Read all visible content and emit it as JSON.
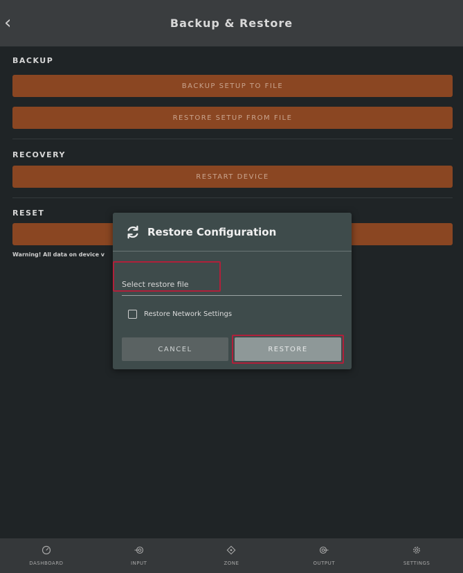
{
  "header": {
    "back_glyph": "‹",
    "title": "Backup & Restore"
  },
  "sections": {
    "backup": {
      "label": "BACKUP",
      "backup_btn": "BACKUP SETUP TO FILE",
      "restore_btn": "RESTORE SETUP FROM FILE"
    },
    "recovery": {
      "label": "RECOVERY",
      "restart_btn": "RESTART DEVICE"
    },
    "reset": {
      "label": "RESET",
      "warning": "Warning! All data on device v"
    }
  },
  "modal": {
    "title": "Restore Configuration",
    "file_field": "Select restore file",
    "checkbox_label": "Restore Network Settings",
    "checkbox_checked": false,
    "cancel": "CANCEL",
    "restore": "RESTORE"
  },
  "bottom_nav": [
    {
      "label": "DASHBOARD",
      "icon": "dashboard-icon"
    },
    {
      "label": "INPUT",
      "icon": "input-icon"
    },
    {
      "label": "ZONE",
      "icon": "zone-icon"
    },
    {
      "label": "OUTPUT",
      "icon": "output-icon"
    },
    {
      "label": "SETTINGS",
      "icon": "settings-icon"
    }
  ],
  "colors": {
    "accent": "#8a4622",
    "highlight": "#b0203a",
    "modal_bg": "#3e4b4b"
  }
}
